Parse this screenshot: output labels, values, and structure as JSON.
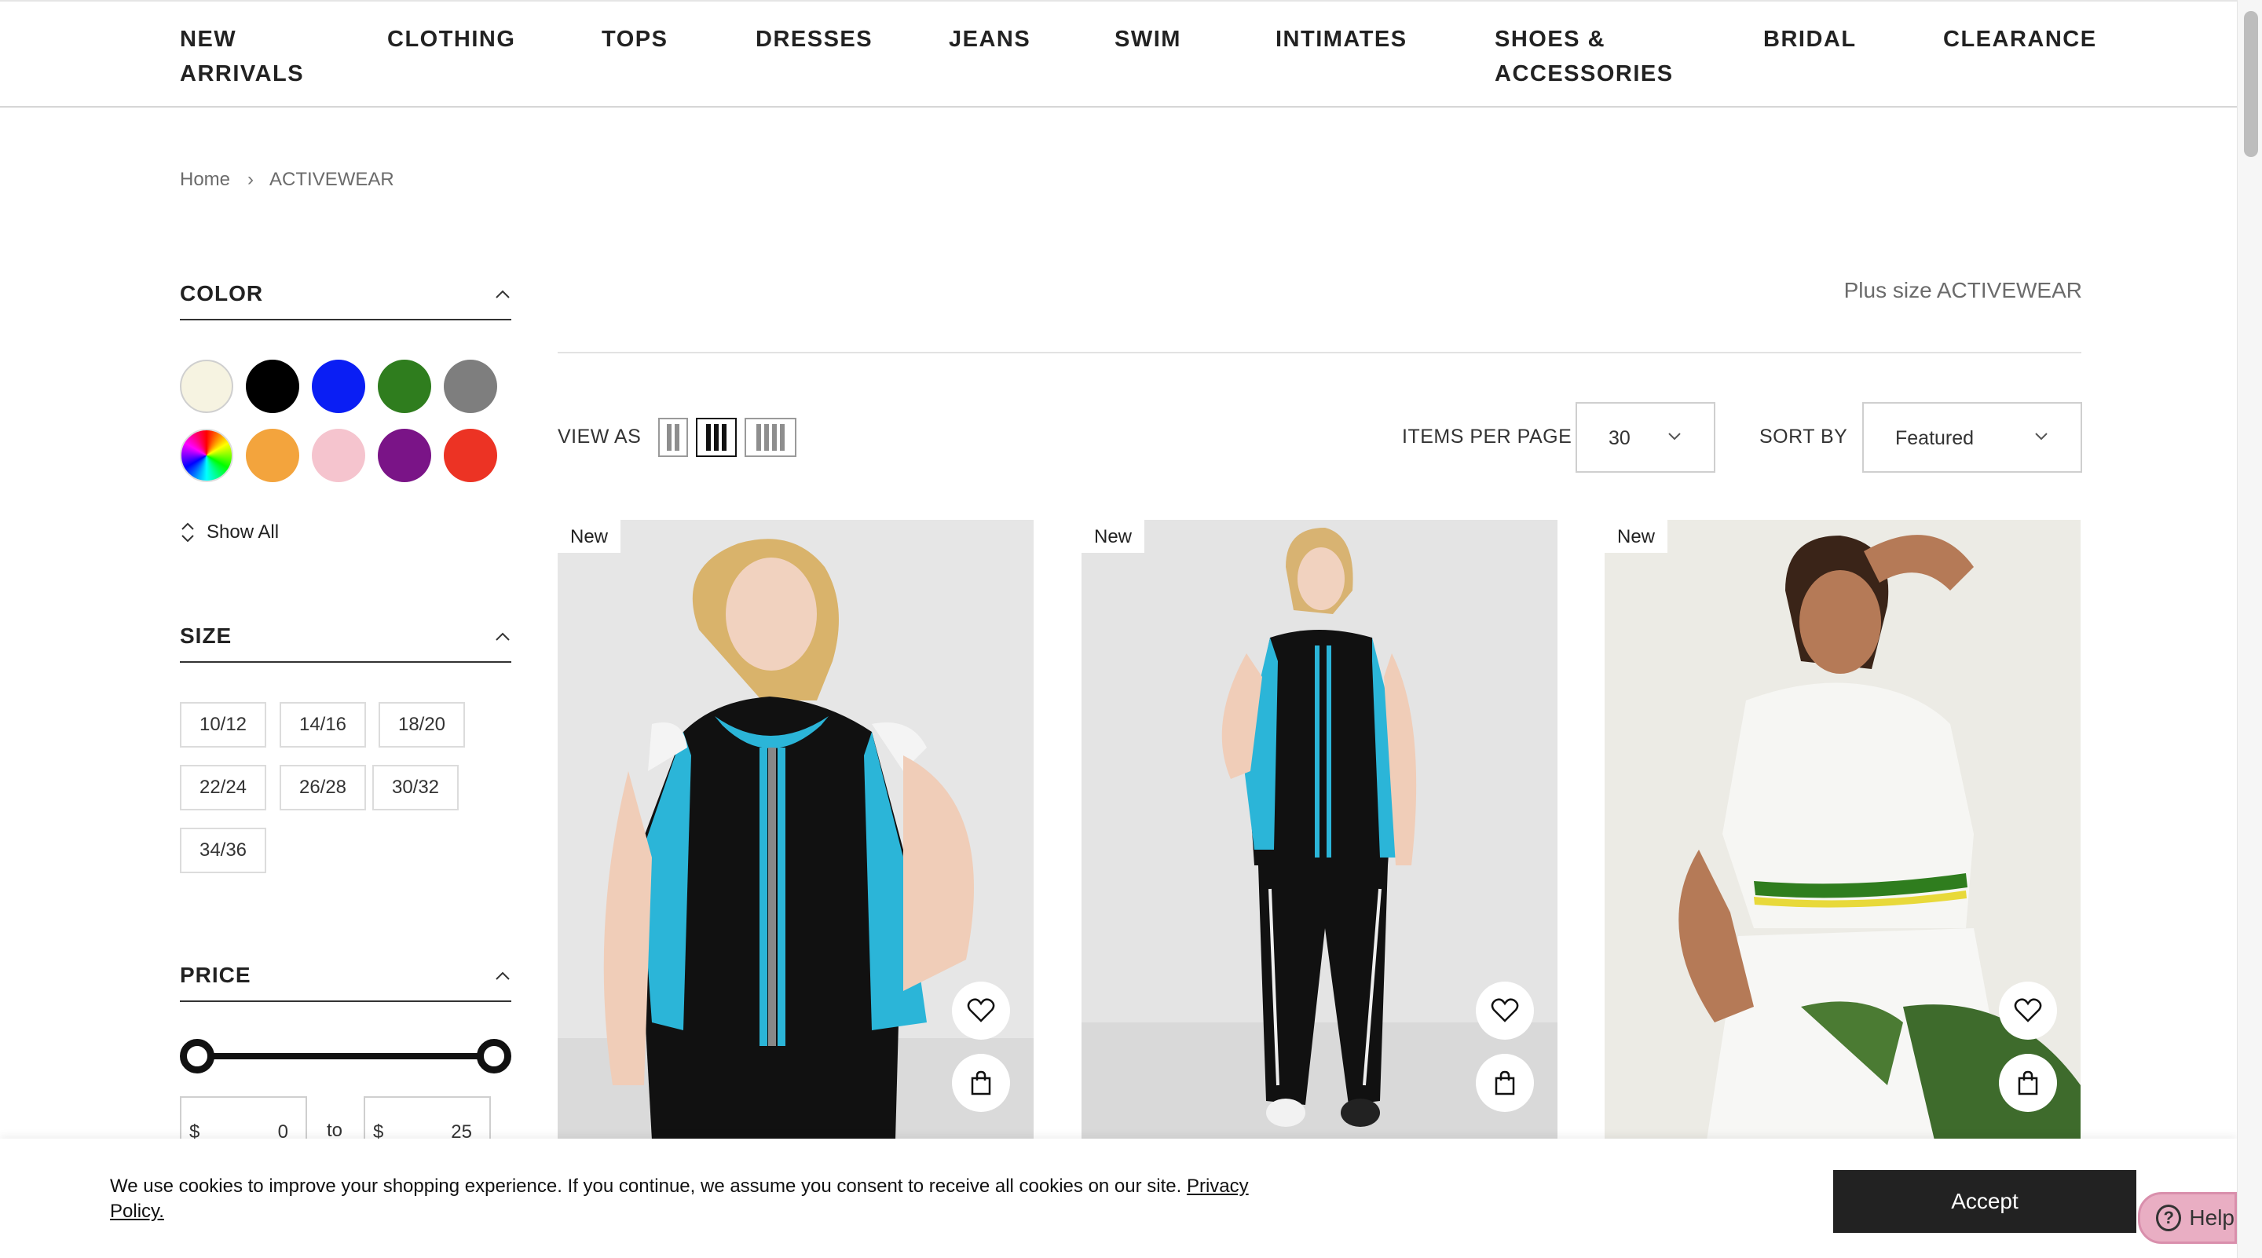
{
  "nav": {
    "items": [
      {
        "label": "NEW\nARRIVALS"
      },
      {
        "label": "CLOTHING"
      },
      {
        "label": "TOPS"
      },
      {
        "label": "DRESSES"
      },
      {
        "label": "JEANS"
      },
      {
        "label": "SWIM"
      },
      {
        "label": "INTIMATES"
      },
      {
        "label": "SHOES &\nACCESSORIES"
      },
      {
        "label": "BRIDAL"
      },
      {
        "label": "CLEARANCE"
      }
    ]
  },
  "breadcrumb": {
    "home": "Home",
    "separator": "›",
    "current": "ACTIVEWEAR"
  },
  "filters": {
    "color": {
      "title": "COLOR",
      "swatches": [
        {
          "name": "ivory",
          "hex": "#f6f3e1"
        },
        {
          "name": "black",
          "hex": "#000000"
        },
        {
          "name": "blue",
          "hex": "#0a1ef4"
        },
        {
          "name": "green",
          "hex": "#2f7d1e"
        },
        {
          "name": "gray",
          "hex": "#7e7e7e"
        },
        {
          "name": "multi",
          "hex": "multicolor"
        },
        {
          "name": "orange",
          "hex": "#f3a43d"
        },
        {
          "name": "pink",
          "hex": "#f5c4ce"
        },
        {
          "name": "purple",
          "hex": "#7a1487"
        },
        {
          "name": "red",
          "hex": "#ec3324"
        }
      ],
      "show_all": "Show All"
    },
    "size": {
      "title": "SIZE",
      "options": [
        "10/12",
        "14/16",
        "18/20",
        "22/24",
        "26/28",
        "30/32",
        "34/36"
      ]
    },
    "price": {
      "title": "PRICE",
      "currency": "$",
      "min": "0",
      "max": "25",
      "to": "to"
    }
  },
  "main": {
    "category_title": "Plus size ACTIVEWEAR",
    "view_as": "VIEW AS",
    "items_per_page_label": "ITEMS PER PAGE",
    "items_per_page_value": "30",
    "sort_by_label": "SORT BY",
    "sort_by_value": "Featured"
  },
  "products": [
    {
      "badge": "New"
    },
    {
      "badge": "New"
    },
    {
      "badge": "New"
    }
  ],
  "cookie": {
    "text": "We use cookies to improve your shopping experience. If you continue, we assume you consent to receive all cookies on our site.",
    "link": "Privacy Policy.",
    "accept": "Accept"
  },
  "help": {
    "label": "Help"
  }
}
